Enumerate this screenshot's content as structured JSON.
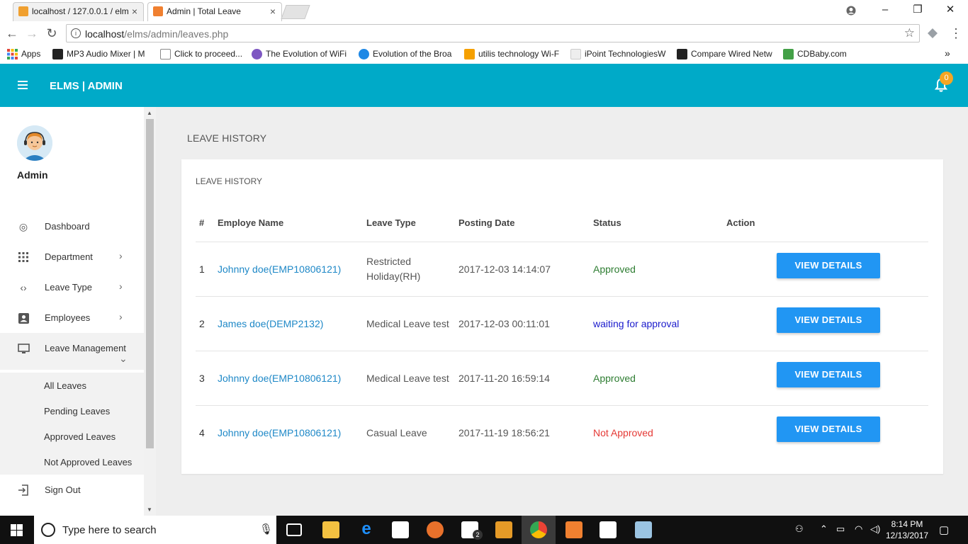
{
  "browser": {
    "tabs": [
      {
        "title": "localhost / 127.0.0.1 / elm",
        "close": "×",
        "fav_color": "#f0a030"
      },
      {
        "title": "Admin | Total Leave",
        "close": "×",
        "fav_color": "#f08030"
      }
    ],
    "window_controls": {
      "minimize": "–",
      "restore": "❐",
      "close": "✕"
    },
    "url_host": "localhost",
    "url_path": "/elms/admin/leaves.php",
    "bookmarks": [
      {
        "label": "Apps",
        "icon_color": "#e0463a"
      },
      {
        "label": "MP3 Audio Mixer | M",
        "icon_color": "#222222"
      },
      {
        "label": "Click to proceed...",
        "icon_color": "#ffffff"
      },
      {
        "label": "The Evolution of WiFi",
        "icon_color": "#7e57c2"
      },
      {
        "label": "Evolution of the Broa",
        "icon_color": "#1e88e5"
      },
      {
        "label": "utilis technology Wi-F",
        "icon_color": "#f5a000"
      },
      {
        "label": "iPoint TechnologiesW",
        "icon_color": "#eeeeee"
      },
      {
        "label": "Compare Wired Netw",
        "icon_color": "#222222"
      },
      {
        "label": "CDBaby.com",
        "icon_color": "#43a047"
      }
    ],
    "bookmarks_more": "»"
  },
  "app": {
    "brand": "ELMS | ADMIN",
    "notification_count": "0",
    "accent": "#00aac8"
  },
  "sidebar": {
    "user_name": "Admin",
    "items": [
      {
        "label": "Dashboard",
        "icon": "dashboard-icon",
        "glyph": "◎",
        "chevron": ""
      },
      {
        "label": "Department",
        "icon": "apps-grid-icon",
        "glyph": "⋮⋮⋮",
        "chevron": "›"
      },
      {
        "label": "Leave Type",
        "icon": "code-icon",
        "glyph": "‹›",
        "chevron": "›"
      },
      {
        "label": "Employees",
        "icon": "account-box-icon",
        "glyph": "▣",
        "chevron": "›"
      },
      {
        "label": "Leave Management",
        "icon": "desktop-icon",
        "glyph": "▭",
        "chevron": "⌄"
      }
    ],
    "sub_items": [
      "All Leaves",
      "Pending Leaves",
      "Approved Leaves",
      "Not Approved Leaves"
    ],
    "sign_out": "Sign Out"
  },
  "main": {
    "page_title": "LEAVE HISTORY",
    "card_title": "LEAVE HISTORY",
    "columns": [
      "#",
      "Employe Name",
      "Leave Type",
      "Posting Date",
      "Status",
      "Action"
    ],
    "rows": [
      {
        "num": "1",
        "name": "Johnny doe(EMP10806121)",
        "type_line1": "Restricted",
        "type_line2": "Holiday(RH)",
        "date": "2017-12-03 14:14:07",
        "status": "Approved",
        "status_color": "#2e7d32",
        "action": "VIEW DETAILS"
      },
      {
        "num": "2",
        "name": "James doe(DEMP2132)",
        "type_line1": "Medical Leave test",
        "type_line2": "",
        "date": "2017-12-03 00:11:01",
        "status": "waiting for approval",
        "status_color": "#1a1acc",
        "action": "VIEW DETAILS"
      },
      {
        "num": "3",
        "name": "Johnny doe(EMP10806121)",
        "type_line1": "Medical Leave test",
        "type_line2": "",
        "date": "2017-11-20 16:59:14",
        "status": "Approved",
        "status_color": "#2e7d32",
        "action": "VIEW DETAILS"
      },
      {
        "num": "4",
        "name": "Johnny doe(EMP10806121)",
        "type_line1": "Casual Leave",
        "type_line2": "",
        "date": "2017-11-19 18:56:21",
        "status": "Not Approved",
        "status_color": "#e53935",
        "action": "VIEW DETAILS"
      }
    ]
  },
  "taskbar": {
    "search_placeholder": "Type here to search",
    "time": "8:14 PM",
    "date": "12/13/2017",
    "mail_badge": "2"
  }
}
